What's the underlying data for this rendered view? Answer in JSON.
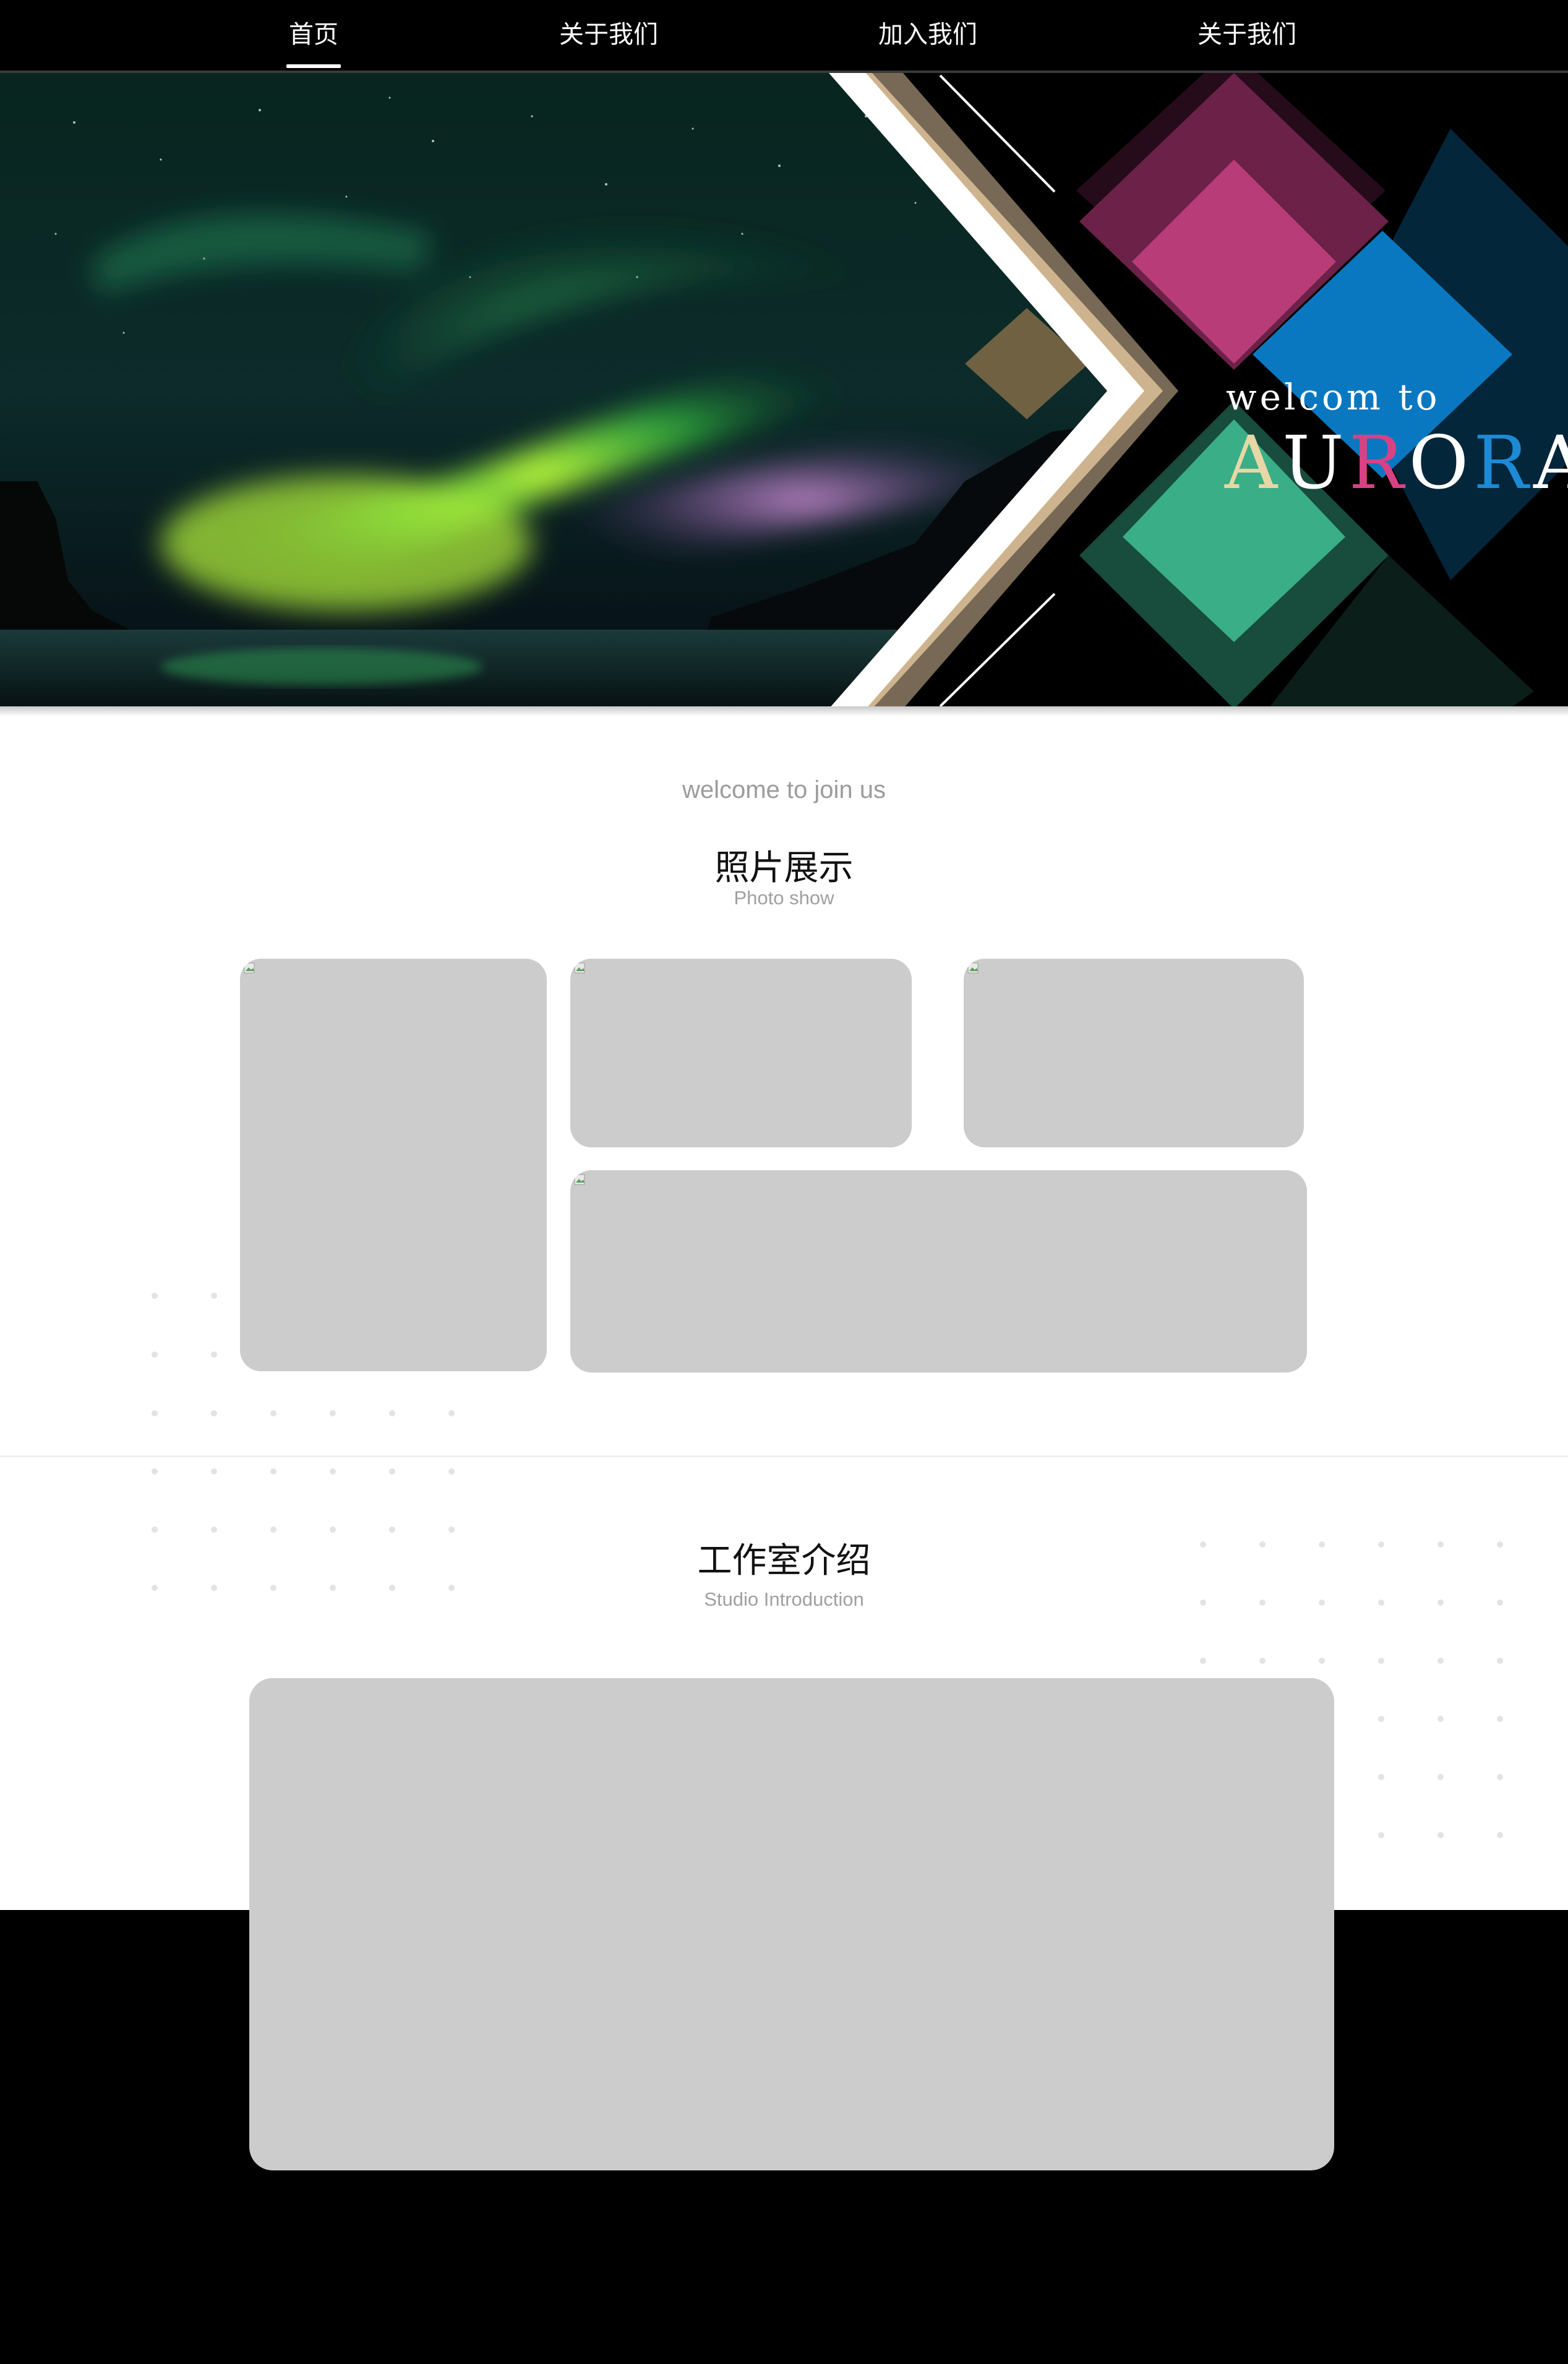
{
  "nav": {
    "items": [
      {
        "label": "首页",
        "active": true
      },
      {
        "label": "关于我们",
        "active": false
      },
      {
        "label": "加入我们",
        "active": false
      },
      {
        "label": "关于我们",
        "active": false
      }
    ]
  },
  "hero": {
    "welcome": "welcom to",
    "title_letters": [
      {
        "char": "A",
        "color": "#e8d7a6"
      },
      {
        "char": "U",
        "color": "#ffffff"
      },
      {
        "char": "R",
        "color": "#d94184"
      },
      {
        "char": "O",
        "color": "#ffffff"
      },
      {
        "char": "R",
        "color": "#1c8ad4"
      },
      {
        "char": "A",
        "color": "#ffffff"
      }
    ]
  },
  "photo_section": {
    "welcome": "welcome to join us",
    "title": "照片展示",
    "subtitle": "Photo show"
  },
  "studio_section": {
    "title": "工作室介绍",
    "subtitle": "Studio Introduction"
  },
  "colors": {
    "nav_bg": "#000000",
    "placeholder_gray": "#cccccc",
    "aurora_green": "#7cf03c",
    "pink_diamond": "#b83c77",
    "blue_diamond": "#0a78c0",
    "teal_diamond": "#3aae86"
  }
}
